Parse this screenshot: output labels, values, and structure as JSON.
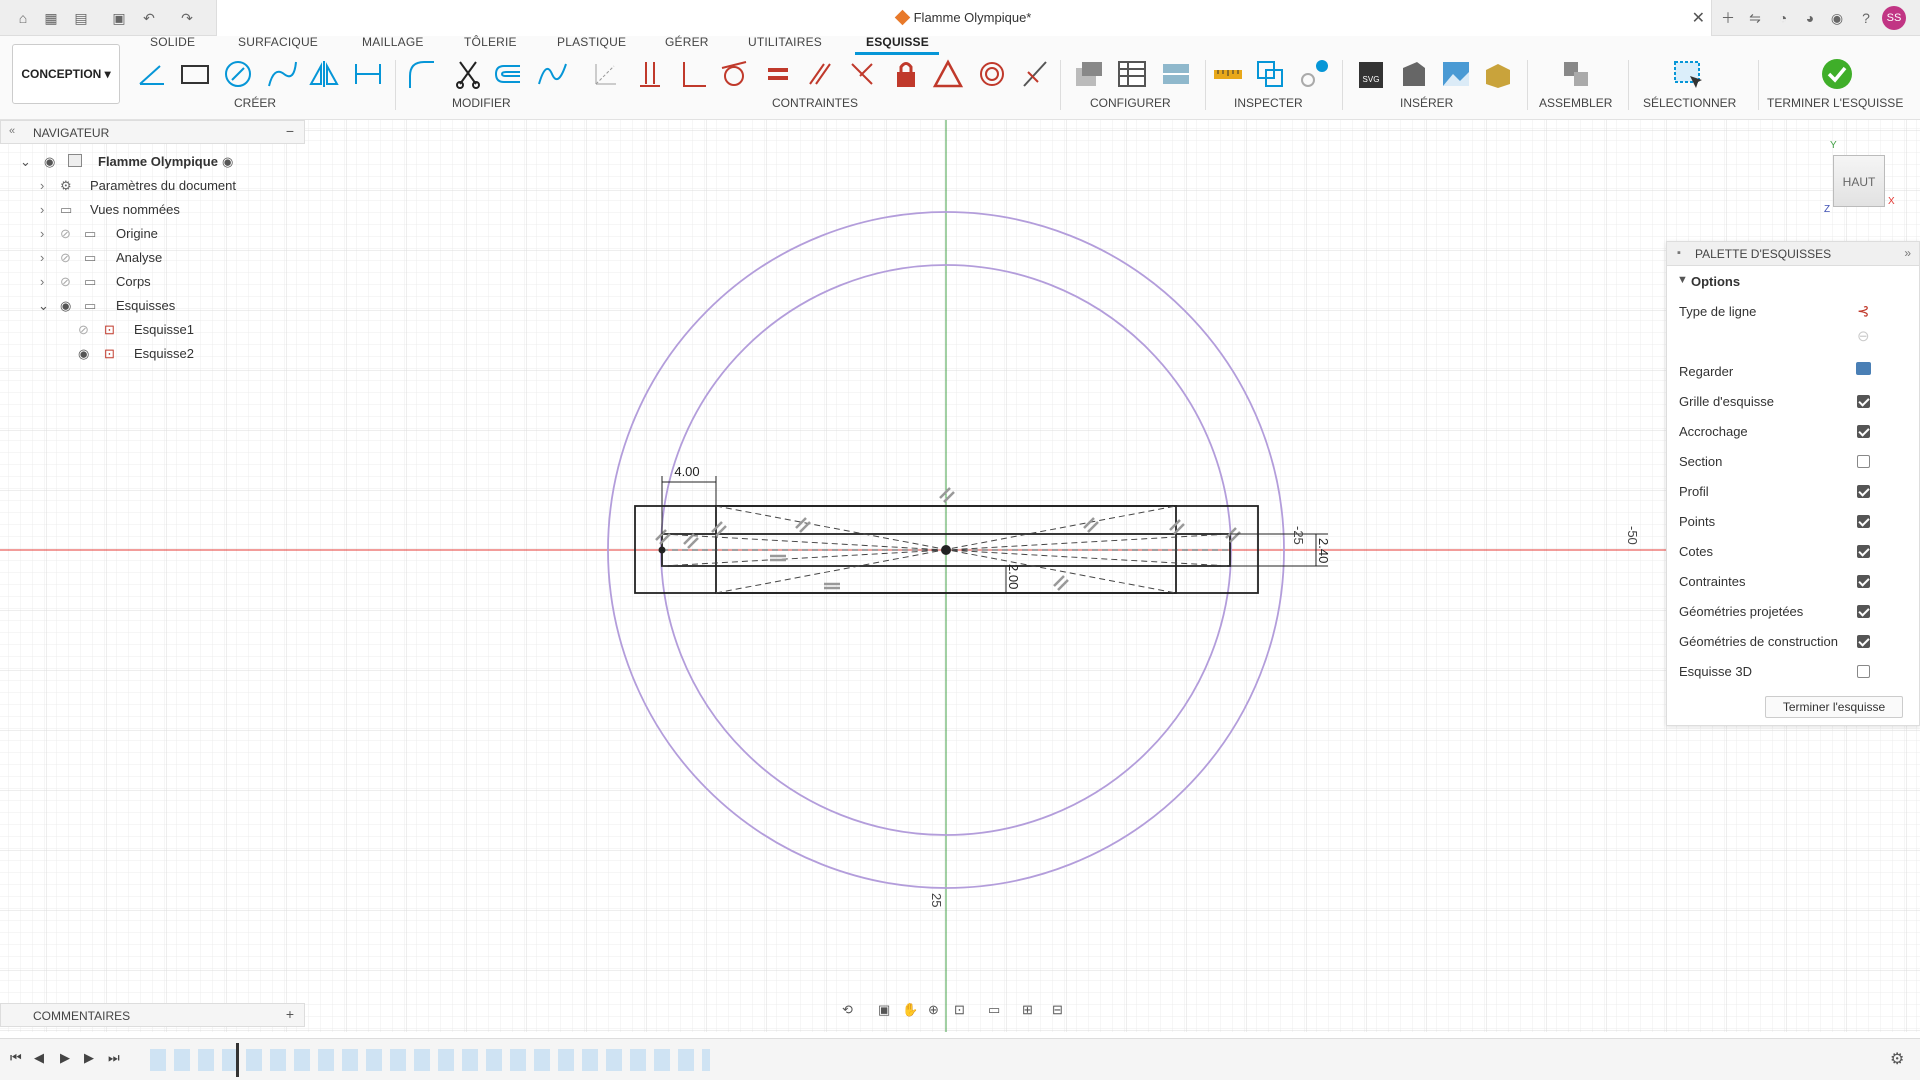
{
  "window": {
    "document_title": "Flamme Olympique*",
    "user_initials": "SS"
  },
  "ribbon": {
    "workspace": "CONCEPTION",
    "tabs": [
      "SOLIDE",
      "SURFACIQUE",
      "MAILLAGE",
      "TÔLERIE",
      "PLASTIQUE",
      "GÉRER",
      "UTILITAIRES",
      "ESQUISSE"
    ],
    "active_tab": "ESQUISSE",
    "groups": [
      "CRÉER",
      "MODIFIER",
      "CONTRAINTES",
      "CONFIGURER",
      "INSPECTER",
      "INSÉRER",
      "ASSEMBLER",
      "SÉLECTIONNER",
      "TERMINER L'ESQUISSE"
    ],
    "svg_icon_text": "SVG"
  },
  "navigator": {
    "title": "NAVIGATEUR",
    "root": "Flamme Olympique",
    "items": [
      "Paramètres du document",
      "Vues nommées",
      "Origine",
      "Analyse",
      "Corps",
      "Esquisses",
      "Esquisse1",
      "Esquisse2"
    ]
  },
  "palette": {
    "title": "PALETTE D'ESQUISSES",
    "section": "Options",
    "rows": {
      "type_ligne": "Type de ligne",
      "regarder": "Regarder",
      "grille": "Grille d'esquisse",
      "accrochage": "Accrochage",
      "section": "Section",
      "profil": "Profil",
      "points": "Points",
      "cotes": "Cotes",
      "contraintes": "Contraintes",
      "geo_projetees": "Géométries projetées",
      "geo_construction": "Géométries de construction",
      "esquisse3d": "Esquisse 3D"
    },
    "checked": {
      "grille": true,
      "accrochage": true,
      "section": false,
      "profil": true,
      "points": true,
      "cotes": true,
      "contraintes": true,
      "geo_projetees": true,
      "geo_construction": true,
      "esquisse3d": false
    },
    "finish_button": "Terminer l'esquisse"
  },
  "sketch": {
    "dim_width": "4.00",
    "dim_height_small": "2.00",
    "dim_right": "2.40",
    "dim_right_small": "-25",
    "axis_label_right": "-50",
    "axis_label_bottom": "25"
  },
  "viewcube": {
    "face": "HAUT"
  },
  "comments": {
    "title": "COMMENTAIRES"
  },
  "colors": {
    "accent": "#0696d7",
    "construction_circle": "#b39ddb",
    "x_axis": "#e53935",
    "y_axis": "#43a047"
  }
}
